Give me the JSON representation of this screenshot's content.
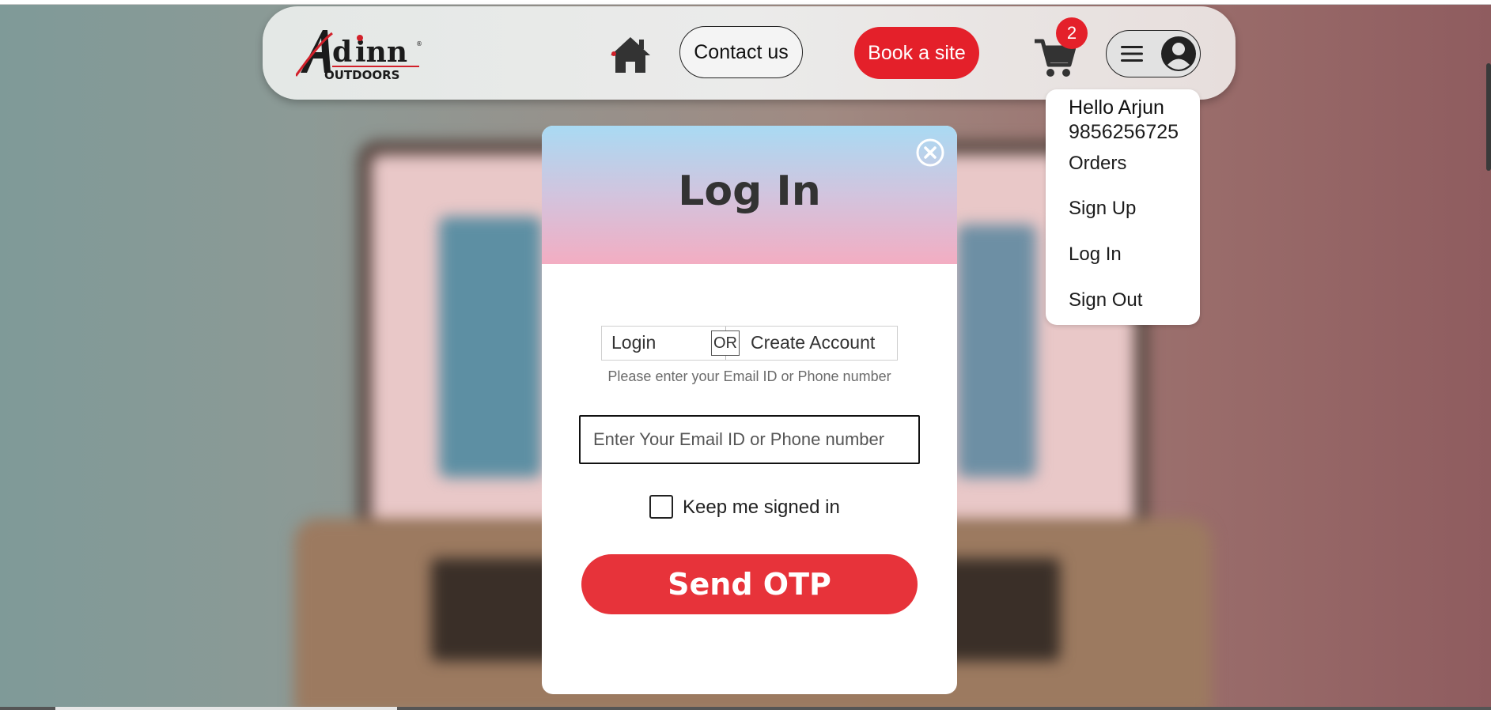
{
  "header": {
    "logo_text": "Ad inn",
    "logo_subtext": "OUTDOORS",
    "contact_label": "Contact us",
    "book_label": "Book a site",
    "cart_count": "2",
    "icons": [
      "home-icon",
      "cart-icon",
      "hamburger-icon",
      "user-avatar-icon"
    ]
  },
  "dropdown": {
    "greeting": "Hello Arjun",
    "phone": "9856256725",
    "items": [
      "Orders",
      "Sign Up",
      "Log In",
      "Sign Out"
    ]
  },
  "modal": {
    "title": "Log In",
    "tab_login": "Login",
    "tab_or": "OR",
    "tab_create": "Create Account",
    "hint": "Please enter your Email ID or Phone number",
    "input_placeholder": "Enter Your Email ID or Phone number",
    "input_value": "",
    "keep_signed_in_label": "Keep me signed in",
    "keep_signed_in_checked": false,
    "send_button": "Send OTP"
  },
  "colors": {
    "brand_red": "#e4202a",
    "send_red": "#e7333a",
    "modal_header_top": "#a9daf3",
    "modal_header_bottom": "#f3adc2"
  }
}
